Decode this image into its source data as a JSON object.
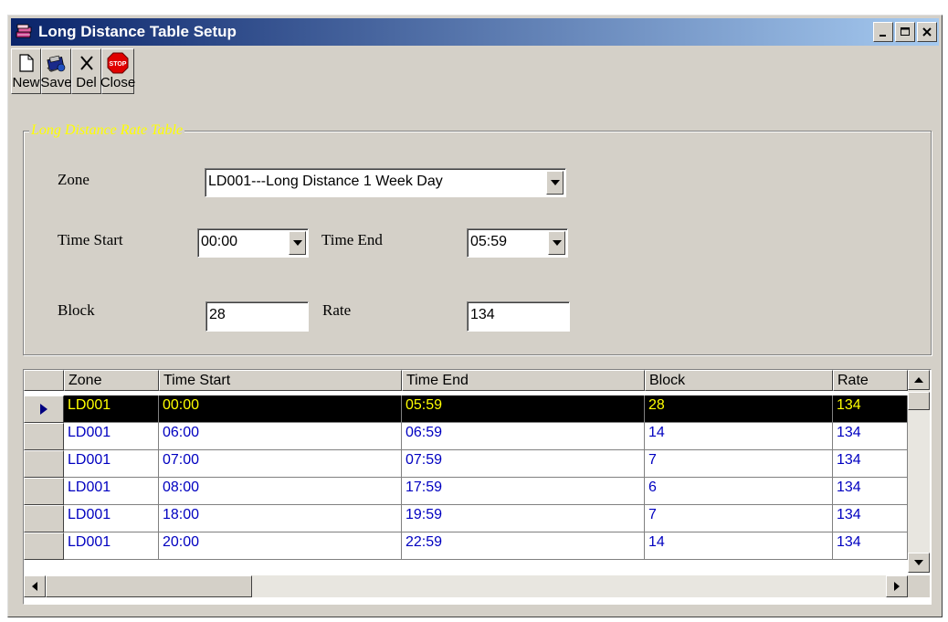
{
  "window": {
    "title": "Long Distance Table Setup"
  },
  "titlebar_buttons": {
    "minimize": "_",
    "maximize": "□",
    "close": "×"
  },
  "toolbar": {
    "new_label": "New",
    "save_label": "Save",
    "del_label": "Del",
    "close_label": "Close",
    "stop_sign_text": "STOP"
  },
  "group": {
    "title": "Long Distance Rate Table"
  },
  "form": {
    "zone_label": "Zone",
    "zone_value": "LD001---Long Distance  1 Week Day",
    "time_start_label": "Time Start",
    "time_start_value": "00:00",
    "time_end_label": "Time End",
    "time_end_value": "05:59",
    "block_label": "Block",
    "block_value": "28",
    "rate_label": "Rate",
    "rate_value": "134"
  },
  "table": {
    "columns": [
      "Zone",
      "Time Start",
      "Time End",
      "Block",
      "Rate"
    ],
    "rows": [
      {
        "zone": "LD001",
        "time_start": "00:00",
        "time_end": "05:59",
        "block": "28",
        "rate": "134",
        "selected": true
      },
      {
        "zone": "LD001",
        "time_start": "06:00",
        "time_end": "06:59",
        "block": "14",
        "rate": "134"
      },
      {
        "zone": "LD001",
        "time_start": "07:00",
        "time_end": "07:59",
        "block": "7",
        "rate": "134"
      },
      {
        "zone": "LD001",
        "time_start": "08:00",
        "time_end": "17:59",
        "block": "6",
        "rate": "134"
      },
      {
        "zone": "LD001",
        "time_start": "18:00",
        "time_end": "19:59",
        "block": "7",
        "rate": "134"
      },
      {
        "zone": "LD001",
        "time_start": "20:00",
        "time_end": "22:59",
        "block": "14",
        "rate": "134"
      }
    ]
  },
  "colors": {
    "title_start": "#0a246a",
    "title_end": "#a6caf0",
    "group_title": "#ffff00",
    "grid_text": "#0000c0",
    "selection_bg": "#000000",
    "selection_text": "#ffff00"
  }
}
